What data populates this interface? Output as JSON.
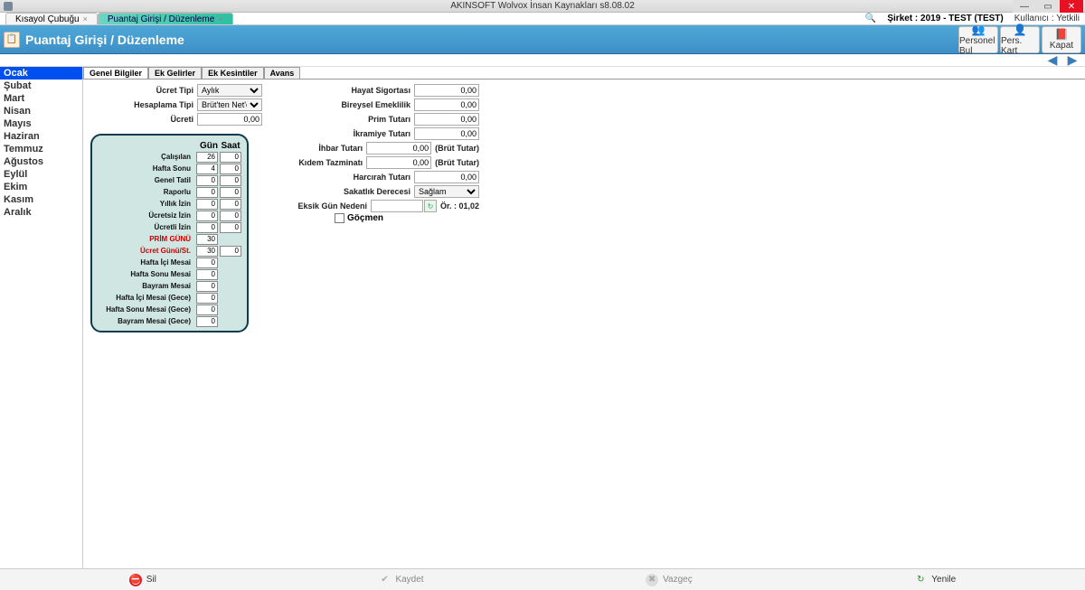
{
  "window": {
    "title": "AKINSOFT Wolvox İnsan Kaynakları s8.08.02",
    "company_label": "Şirket : 2019 - TEST (TEST)",
    "user_label": "Kullanıcı : Yetkili"
  },
  "tabs": [
    {
      "label": "Kısayol Çubuğu",
      "active": false
    },
    {
      "label": "Puantaj Girişi / Düzenleme",
      "active": true
    }
  ],
  "header": {
    "title": "Puantaj Girişi / Düzenleme",
    "buttons": [
      {
        "label": "Personel Bul"
      },
      {
        "label": "Pers. Kart"
      },
      {
        "label": "Kapat"
      }
    ]
  },
  "months": [
    "Ocak",
    "Şubat",
    "Mart",
    "Nisan",
    "Mayıs",
    "Haziran",
    "Temmuz",
    "Ağustos",
    "Eylül",
    "Ekim",
    "Kasım",
    "Aralık"
  ],
  "selected_month": "Ocak",
  "sub_tabs": [
    "Genel Bilgiler",
    "Ek Gelirler",
    "Ek Kesintiler",
    "Avans"
  ],
  "active_sub_tab": "Genel Bilgiler",
  "left_fields": {
    "ucret_tipi_label": "Ücret Tipi",
    "ucret_tipi_value": "Aylık",
    "hesaplama_tipi_label": "Hesaplama Tipi",
    "hesaplama_tipi_value": "Brüt'ten Net'e",
    "ucreti_label": "Ücreti",
    "ucreti_value": "0,00"
  },
  "attendance": {
    "gun_header": "Gün",
    "saat_header": "Saat",
    "rows": [
      {
        "label": "Çalışılan",
        "gun": "26",
        "saat": "0"
      },
      {
        "label": "Hafta Sonu",
        "gun": "4",
        "saat": "0"
      },
      {
        "label": "Genel Tatil",
        "gun": "0",
        "saat": "0"
      },
      {
        "label": "Raporlu",
        "gun": "0",
        "saat": "0"
      },
      {
        "label": "Yıllık İzin",
        "gun": "0",
        "saat": "0"
      },
      {
        "label": "Ücretsiz İzin",
        "gun": "0",
        "saat": "0"
      },
      {
        "label": "Ücretli İzin",
        "gun": "0",
        "saat": "0"
      },
      {
        "label": "PRİM GÜNÜ",
        "gun": "30",
        "red": true,
        "no_saat": true
      },
      {
        "label": "Ücret Günü/St.",
        "gun": "30",
        "saat": "0",
        "red": true
      },
      {
        "label": "Hafta İçi Mesai",
        "gun": "0",
        "no_saat": true
      },
      {
        "label": "Hafta Sonu Mesai",
        "gun": "0",
        "no_saat": true
      },
      {
        "label": "Bayram Mesai",
        "gun": "0",
        "no_saat": true
      },
      {
        "label": "Hafta İçi Mesai (Gece)",
        "gun": "0",
        "no_saat": true
      },
      {
        "label": "Hafta Sonu Mesai (Gece)",
        "gun": "0",
        "no_saat": true
      },
      {
        "label": "Bayram Mesai (Gece)",
        "gun": "0",
        "no_saat": true
      }
    ]
  },
  "mid_fields": [
    {
      "label": "Hayat Sigortası",
      "value": "0,00"
    },
    {
      "label": "Bireysel Emeklilik",
      "value": "0,00"
    },
    {
      "label": "Prim Tutarı",
      "value": "0,00"
    },
    {
      "label": "İkramiye Tutarı",
      "value": "0,00"
    },
    {
      "label": "İhbar Tutarı",
      "value": "0,00",
      "note": "(Brüt Tutar)"
    },
    {
      "label": "Kıdem Tazminatı",
      "value": "0,00",
      "note": "(Brüt Tutar)"
    },
    {
      "label": "Harcırah Tutarı",
      "value": "0,00"
    },
    {
      "label": "Sakatlık Derecesi",
      "select": "Sağlam"
    },
    {
      "label": "Eksik Gün Nedeni",
      "eksik": true,
      "note": "Ör. : 01,02"
    }
  ],
  "gocmen_label": "Göçmen",
  "footer": {
    "sil": "Sil",
    "kaydet": "Kaydet",
    "vazgec": "Vazgeç",
    "yenile": "Yenile"
  }
}
